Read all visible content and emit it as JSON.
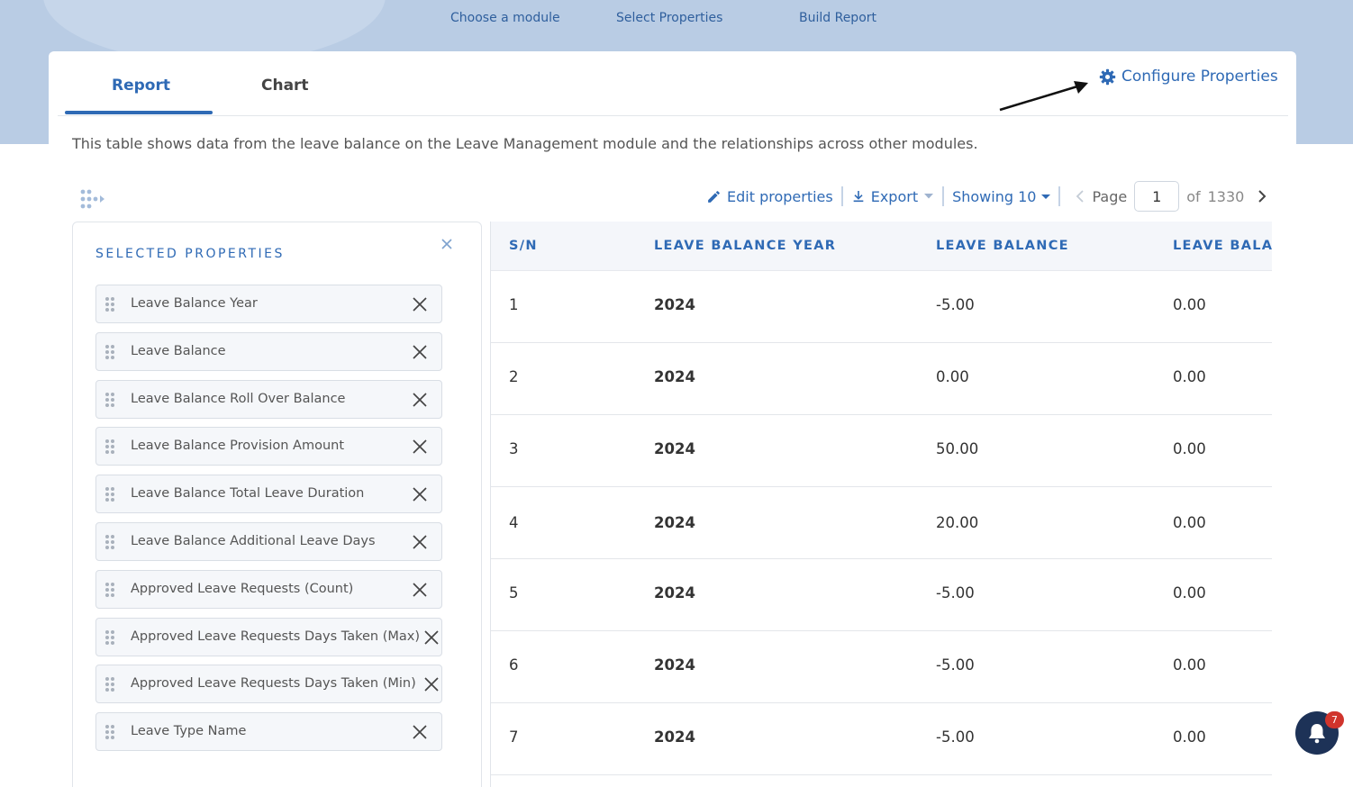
{
  "wizard_steps": [
    "Choose a module",
    "Select Properties",
    "Build Report"
  ],
  "tabs": {
    "report": "Report",
    "chart": "Chart"
  },
  "configure_label": "Configure Properties",
  "description": "This table shows data from the leave balance on the Leave Management module and the relationships across other modules.",
  "toolbar": {
    "edit_label": "Edit properties",
    "export_label": "Export",
    "showing_label": "Showing 10",
    "page_label": "Page",
    "page_value": "1",
    "of_label": "of",
    "total_pages": "1330"
  },
  "panel": {
    "title": "SELECTED PROPERTIES",
    "items": [
      "Leave Balance Year",
      "Leave Balance",
      "Leave Balance Roll Over Balance",
      "Leave Balance Provision Amount",
      "Leave Balance Total Leave Duration",
      "Leave Balance Additional Leave Days",
      "Approved Leave Requests (Count)",
      "Approved Leave Requests Days Taken (Max)",
      "Approved Leave Requests Days Taken (Min)",
      "Leave Type Name"
    ]
  },
  "table": {
    "headers": [
      "S/N",
      "LEAVE BALANCE YEAR",
      "LEAVE BALANCE",
      "LEAVE BALANCE ROLL OVER BALANCE"
    ],
    "rows": [
      [
        "1",
        "2024",
        "-5.00",
        "0.00"
      ],
      [
        "2",
        "2024",
        "0.00",
        "0.00"
      ],
      [
        "3",
        "2024",
        "50.00",
        "0.00"
      ],
      [
        "4",
        "2024",
        "20.00",
        "0.00"
      ],
      [
        "5",
        "2024",
        "-5.00",
        "0.00"
      ],
      [
        "6",
        "2024",
        "-5.00",
        "0.00"
      ],
      [
        "7",
        "2024",
        "-5.00",
        "0.00"
      ]
    ]
  },
  "notifications": {
    "count": "7"
  },
  "icons": {
    "configure": "gear-icon",
    "edit": "pencil-icon",
    "export": "download-icon",
    "bell": "bell-icon"
  },
  "colors": {
    "accent": "#2f6ab5",
    "band": "#b9cce4",
    "bell": "#1d3257",
    "badge": "#d0342c"
  }
}
